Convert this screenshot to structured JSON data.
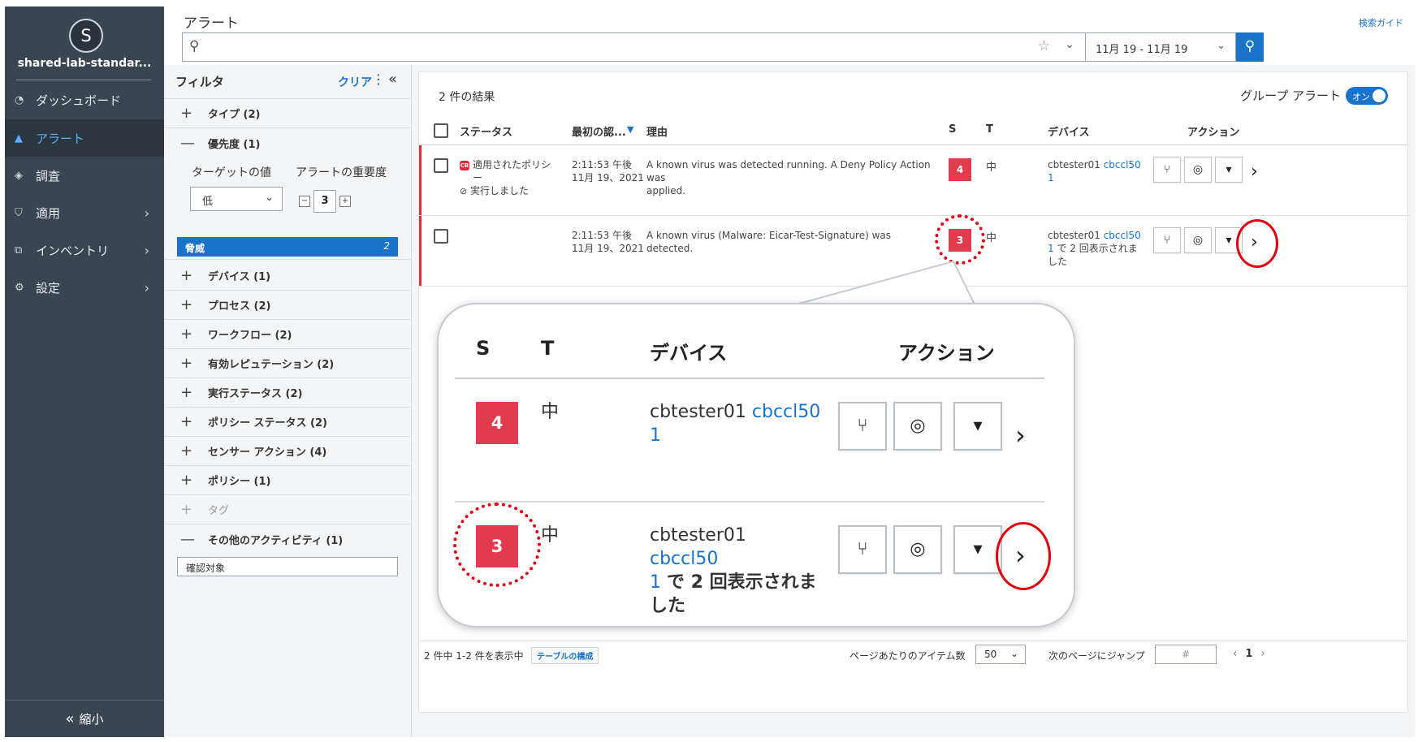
{
  "nav": {
    "avatar_letter": "S",
    "org_name": "shared-lab-standar...",
    "items": [
      {
        "label": "ダッシュボード",
        "icon": "dashboard-icon"
      },
      {
        "label": "アラート",
        "icon": "alert-triangle-icon"
      },
      {
        "label": "調査",
        "icon": "investigate-icon"
      },
      {
        "label": "適用",
        "icon": "shield-check-icon"
      },
      {
        "label": "インベントリ",
        "icon": "inventory-icon"
      },
      {
        "label": "設定",
        "icon": "gear-icon"
      }
    ],
    "collapse_label": "縮小"
  },
  "topbar": {
    "title": "アラート",
    "search_guide": "検索ガイド",
    "search_value": "",
    "date_range": "11月 19 - 11月 19"
  },
  "filter": {
    "title": "フィルタ",
    "clear": "クリア",
    "sections": [
      {
        "label": "タイプ (2)",
        "sign": "+"
      },
      {
        "label": "優先度 (1)",
        "sign": "—"
      },
      {
        "label": "デバイス (1)",
        "sign": "+"
      },
      {
        "label": "プロセス (2)",
        "sign": "+"
      },
      {
        "label": "ワークフロー (2)",
        "sign": "+"
      },
      {
        "label": "有効レピュテーション (2)",
        "sign": "+"
      },
      {
        "label": "実行ステータス (2)",
        "sign": "+"
      },
      {
        "label": "ポリシー ステータス (2)",
        "sign": "+"
      },
      {
        "label": "センサー アクション (4)",
        "sign": "+"
      },
      {
        "label": "ポリシー (1)",
        "sign": "+"
      },
      {
        "label": "タグ",
        "sign": "+"
      },
      {
        "label": "その他のアクティビティ (1)",
        "sign": "—"
      }
    ],
    "priority": {
      "target_label": "ターゲットの値",
      "severity_label": "アラートの重要度",
      "target_value": "低",
      "severity_value": "3",
      "threat_label": "脅威",
      "threat_count": "2"
    },
    "other_activity_value": "確認対象"
  },
  "results": {
    "count": "2 件の結果",
    "group_label": "グループ アラート",
    "toggle": "オン",
    "columns": {
      "status": "ステータス",
      "first_seen": "最初の認...",
      "reason": "理由",
      "s": "S",
      "t": "T",
      "device": "デバイス",
      "action": "アクション"
    },
    "rows": [
      {
        "status_line1": "適用されたポリシ",
        "status_line2": "ー",
        "status_exec": "実行しました",
        "time": "2:11:53 午後",
        "date": "11月 19、2021",
        "reason_line1": "A known virus was detected running. A Deny Policy Action was",
        "reason_line2": "applied.",
        "severity": "4",
        "t": "中",
        "device_name": "cbtester01",
        "device_link1": "cbccl50",
        "device_link2": "1",
        "device_extra1": "",
        "device_extra2": ""
      },
      {
        "status_line1": "",
        "status_line2": "",
        "status_exec": "",
        "time": "2:11:53 午後",
        "date": "11月 19、2021",
        "reason_line1": "A known virus (Malware: Eicar-Test-Signature) was detected.",
        "reason_line2": "",
        "severity": "3",
        "t": "中",
        "device_name": "cbtester01",
        "device_link1": "cbccl50",
        "device_link2": "1",
        "device_extra1": "で 2 回表示されま",
        "device_extra2": "した"
      }
    ],
    "footer": {
      "showing": "2 件中 1-2 件を表示中",
      "configure": "テーブルの構成",
      "per_page_label": "ページあたりのアイテム数",
      "per_page": "50",
      "jump_label": "次のページにジャンプ",
      "jump_placeholder": "#",
      "page": "1"
    }
  },
  "callout": {
    "columns": {
      "s": "S",
      "t": "T",
      "device": "デバイス",
      "action": "アクション"
    }
  },
  "colors": {
    "nav_bg": "#394551",
    "accent": "#1a73c9",
    "severity": "#e23b4e",
    "highlight": "#e3000f"
  }
}
